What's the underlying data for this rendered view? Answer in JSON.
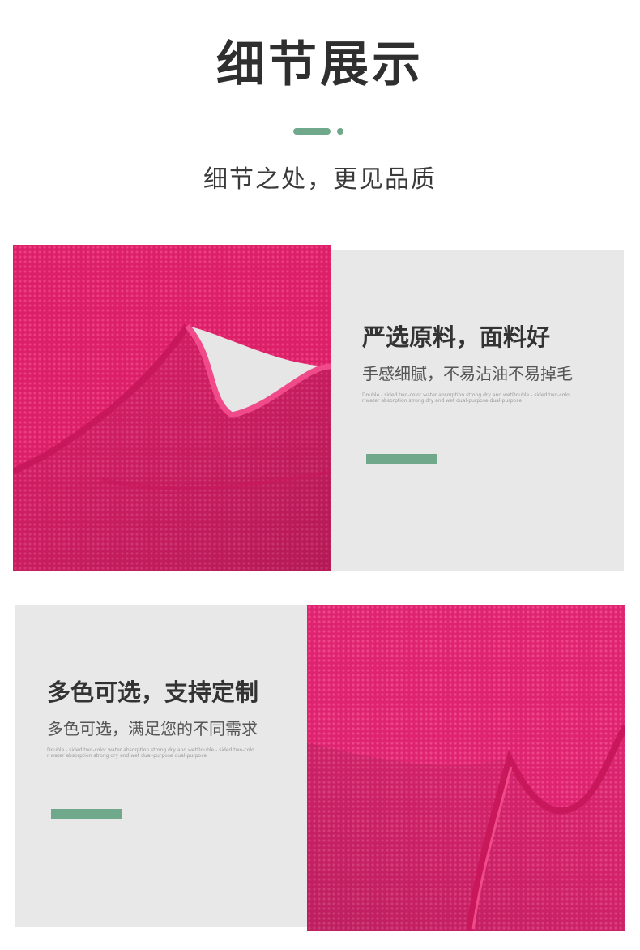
{
  "header": {
    "title": "细节展示",
    "subtitle": "细节之处，更见品质"
  },
  "colors": {
    "accent": "#6fa88a",
    "panel": "#e8e8e8",
    "fabric": "#e0226e"
  },
  "sections": [
    {
      "heading": "严选原料，面料好",
      "description": "手感细腻，不易沾油不易掉毛",
      "fine_print_1": "Double - sided two-color water absorption strong dry and wetDouble - sided two-colo",
      "fine_print_2": "r water absorption strong dry and wet dual-purpose dual-purpose",
      "image": "pink-microfiber-towel-closeup"
    },
    {
      "heading": "多色可选，支持定制",
      "description": "多色可选，满足您的不同需求",
      "fine_print_1": "Double - sided two-color water absorption strong dry and wetDouble - sided two-colo",
      "fine_print_2": "r water absorption strong dry and wet dual-purpose dual-purpose",
      "image": "pink-microfiber-towel-folded"
    }
  ]
}
